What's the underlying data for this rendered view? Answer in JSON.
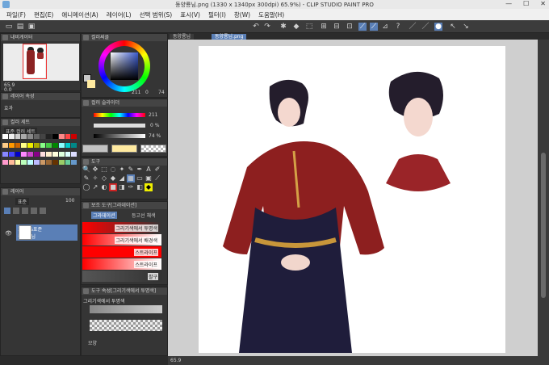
{
  "window": {
    "title": "동양룡님.png (1330 x 1340px 300dpi) 65.9%) - CLIP STUDIO PAINT PRO",
    "min": "—",
    "max": "☐",
    "close": "✕"
  },
  "menu": [
    "파일(F)",
    "편집(E)",
    "애니메이션(A)",
    "레이어(L)",
    "선택 범위(S)",
    "표시(V)",
    "필터(I)",
    "창(W)",
    "도움말(H)"
  ],
  "doc_tabs": [
    "동양룡님",
    "동양룡님.png"
  ],
  "panels": {
    "navigator": {
      "title": "내비게이터",
      "zoom": "65.9",
      "angle": "0.0"
    },
    "layer_property": {
      "title": "레이어 속성",
      "effect": "효과"
    },
    "color_set": {
      "title": "컬러 세트",
      "set_name": "표준 컬러 세트"
    },
    "layer": {
      "title": "레이어",
      "blend": "표준",
      "opacity": "100",
      "layer_opacity": "100 %표준",
      "layer_name": "동양룡님"
    },
    "color_wheel": {
      "title": "컬러써클",
      "h": "211",
      "s": "0",
      "v": "74"
    },
    "color_slider": {
      "title": "컬러 슬라이더",
      "r": "211",
      "g": "0 %",
      "b": "74 %"
    },
    "tool": {
      "title": "도구"
    },
    "sub_tool": {
      "title": "보조 도구[그라데이션]",
      "tab1": "그라데이션",
      "tab2": "등고선 채색"
    },
    "gradients": [
      {
        "label": "그리기색에서 투명색",
        "from": "#ff0000",
        "to": "rgba(255,0,0,0)"
      },
      {
        "label": "그리기색에서 배경색",
        "from": "#ff0000",
        "to": "#ffffff"
      },
      {
        "label": "스트라이프",
        "from": "#ff0000",
        "to": "#ff0000"
      },
      {
        "label": "스트라이프",
        "from": "#ff0000",
        "to": "#ffffff"
      },
      {
        "label": "팔구",
        "from": "#555555",
        "to": "#333333"
      }
    ],
    "tool_property": {
      "title": "도구 속성[그리기색에서 투명색]",
      "preset": "그리기색에서 투명색",
      "shape": "모양"
    }
  },
  "status": {
    "zoom": "65.9"
  },
  "colors": {
    "accent": "#5a7fb6",
    "main_color": "#ffeaa0",
    "sub_color": "#ffffff"
  }
}
